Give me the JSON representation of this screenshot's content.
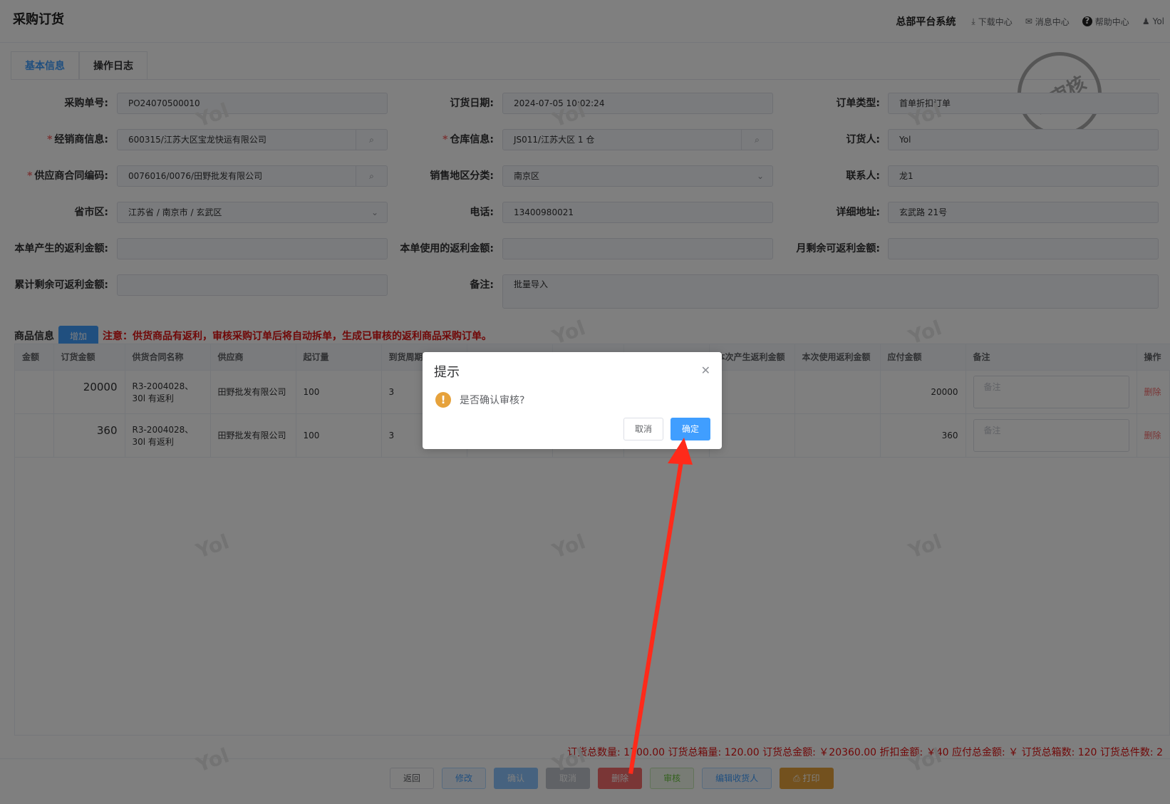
{
  "header": {
    "title": "采购订货",
    "system": "总部平台系统",
    "nav": [
      {
        "icon": "download-icon",
        "glyph": "⤓",
        "label": "下载中心"
      },
      {
        "icon": "mail-icon",
        "glyph": "✉",
        "label": "消息中心"
      },
      {
        "icon": "help-icon",
        "glyph": "?",
        "label": "帮助中心"
      },
      {
        "icon": "user-icon",
        "glyph": "♟",
        "label": "Yol"
      }
    ]
  },
  "tabs": [
    "基本信息",
    "操作日志"
  ],
  "stamp": "未审核",
  "form": {
    "po_no": {
      "label": "采购单号:",
      "value": "PO24070500010"
    },
    "order_date": {
      "label": "订货日期:",
      "value": "2024-07-05 10:02:24"
    },
    "order_type": {
      "label": "订单类型:",
      "value": "首单折扣订单"
    },
    "dealer": {
      "label": "经销商信息:",
      "value": "600315/江苏大区宝龙快运有限公司"
    },
    "warehouse": {
      "label": "仓库信息:",
      "value": "JS011/江苏大区 1 仓"
    },
    "orderer": {
      "label": "订货人:",
      "value": "Yol"
    },
    "contract": {
      "label": "供应商合同编码:",
      "value": "0076016/0076/田野批发有限公司"
    },
    "region": {
      "label": "销售地区分类:",
      "value": "南京区"
    },
    "contact": {
      "label": "联系人:",
      "value": "龙1"
    },
    "province": {
      "label": "省市区:",
      "value": "江苏省 / 南京市 / 玄武区"
    },
    "phone": {
      "label": "电话:",
      "value": "13400980021"
    },
    "address": {
      "label": "详细地址:",
      "value": "玄武路 21号"
    },
    "rebate_gen": {
      "label": "本单产生的返利金额:",
      "value": ""
    },
    "rebate_used": {
      "label": "本单使用的返利金额:",
      "value": ""
    },
    "rebate_month": {
      "label": "月剩余可返利金额:",
      "value": ""
    },
    "rebate_total": {
      "label": "累计剩余可返利金额:",
      "value": ""
    },
    "remark": {
      "label": "备注:",
      "value": "批量导入"
    }
  },
  "goods": {
    "title": "商品信息",
    "add_label": "增加",
    "note": "注意：供货商品有返利，审核采购订单后将自动拆单，生成已审核的返利商品采购订单。",
    "columns": [
      "金额",
      "订货金额",
      "供货合同名称",
      "供应商",
      "起订量",
      "到货周期",
      "",
      "",
      "",
      "本次产生返利金额",
      "本次使用返利金额",
      "应付金额",
      "备注",
      "操作"
    ],
    "rows": [
      {
        "amount": "20000",
        "contract": "R3-2004028、30l 有返利",
        "supplier": "田野批发有限公司",
        "moq": "100",
        "cycle": "3",
        "payable": "20000",
        "remark_ph": "备注",
        "op": "删除"
      },
      {
        "amount": "360",
        "contract": "R3-2004028、30l 有返利",
        "supplier": "田野批发有限公司",
        "moq": "100",
        "cycle": "3",
        "payable": "360",
        "remark_ph": "备注",
        "op": "删除"
      }
    ]
  },
  "summary": "订货总数量: 1700.00   订货总箱量: 120.00   订货总金额: ￥20360.00   折扣金额: ￥40   应付总金额: ￥   订货总箱数: 120   订货总件数: 2",
  "actions": [
    "返回",
    "修改",
    "确认",
    "取消",
    "删除",
    "审核",
    "编辑收货人",
    "打印"
  ],
  "dialog": {
    "title": "提示",
    "message": "是否确认审核?",
    "cancel": "取消",
    "confirm": "确定"
  },
  "watermark": "Yol",
  "colors": {
    "primary": "#409eff",
    "danger": "#f56c6c",
    "warning": "#e6a23c",
    "annotation": "#ff2a1a"
  }
}
